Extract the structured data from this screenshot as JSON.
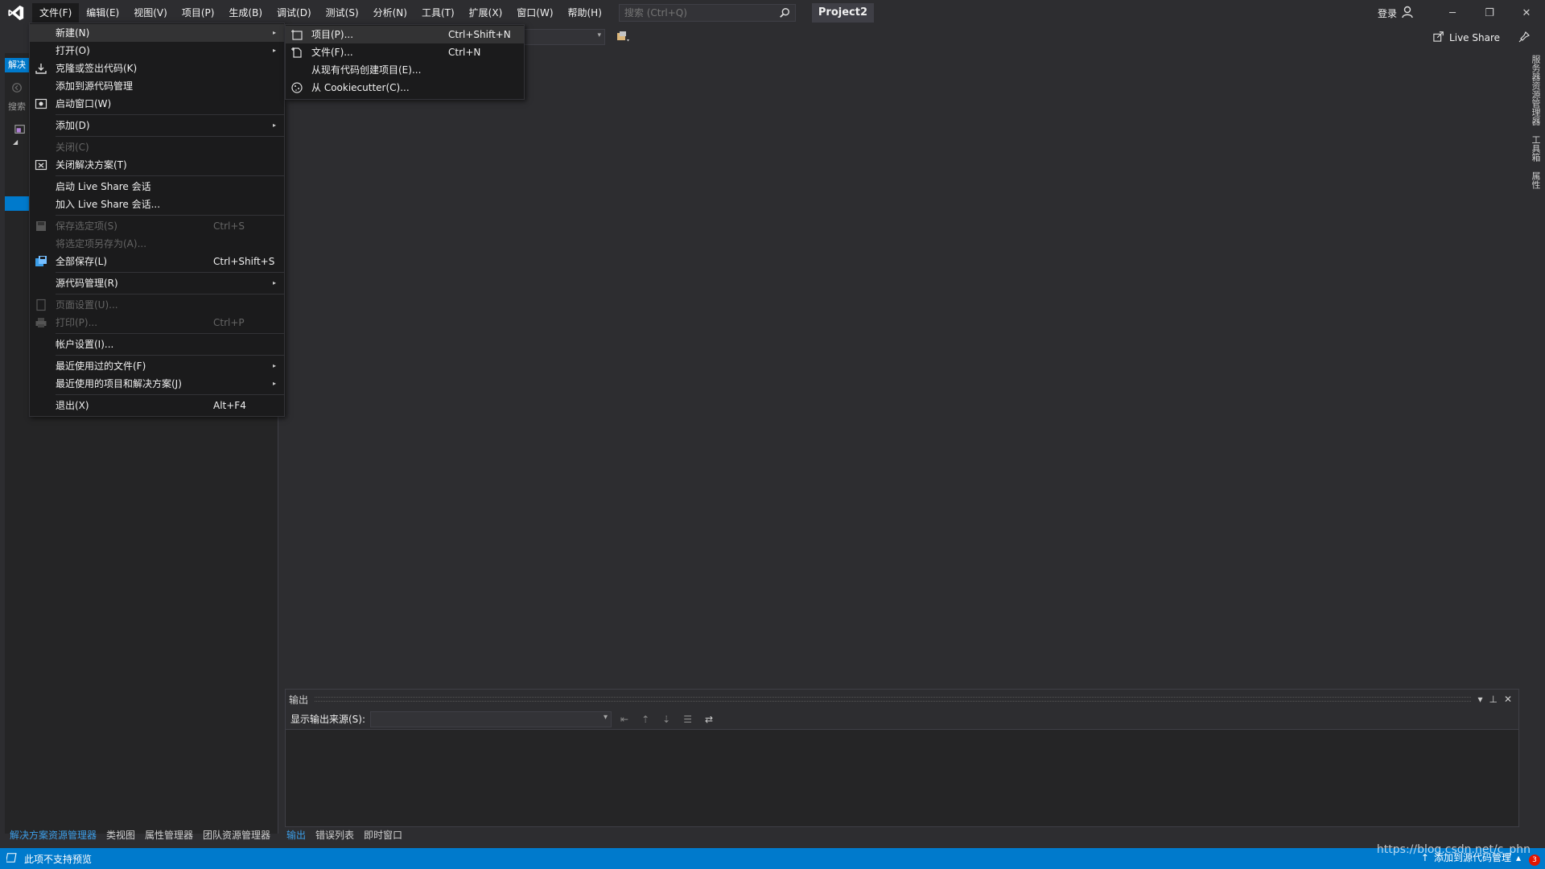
{
  "menubar": {
    "items": [
      "文件(F)",
      "编辑(E)",
      "视图(V)",
      "项目(P)",
      "生成(B)",
      "调试(D)",
      "测试(S)",
      "分析(N)",
      "工具(T)",
      "扩展(X)",
      "窗口(W)",
      "帮助(H)"
    ]
  },
  "search": {
    "placeholder": "搜索 (Ctrl+Q)"
  },
  "project_name": "Project2",
  "signin": "登录",
  "liveshare": "Live Share",
  "left_panel": {
    "tab": "解决",
    "search": "搜索"
  },
  "file_menu": {
    "items": [
      {
        "label": "新建(N)",
        "shortcut": "",
        "arrow": "▸"
      },
      {
        "label": "打开(O)",
        "shortcut": "",
        "arrow": "▸"
      },
      {
        "label": "克隆或签出代码(K)",
        "shortcut": ""
      },
      {
        "label": "添加到源代码管理",
        "shortcut": ""
      },
      {
        "label": "启动窗口(W)",
        "shortcut": ""
      },
      {
        "label": "添加(D)",
        "shortcut": "",
        "arrow": "▸"
      },
      {
        "label": "关闭(C)",
        "shortcut": ""
      },
      {
        "label": "关闭解决方案(T)",
        "shortcut": ""
      },
      {
        "label": "启动 Live Share 会话",
        "shortcut": ""
      },
      {
        "label": "加入 Live Share 会话...",
        "shortcut": ""
      },
      {
        "label": "保存选定项(S)",
        "shortcut": "Ctrl+S"
      },
      {
        "label": "将选定项另存为(A)...",
        "shortcut": ""
      },
      {
        "label": "全部保存(L)",
        "shortcut": "Ctrl+Shift+S"
      },
      {
        "label": "源代码管理(R)",
        "shortcut": "",
        "arrow": "▸"
      },
      {
        "label": "页面设置(U)...",
        "shortcut": ""
      },
      {
        "label": "打印(P)...",
        "shortcut": "Ctrl+P"
      },
      {
        "label": "帐户设置(I)...",
        "shortcut": ""
      },
      {
        "label": "最近使用过的文件(F)",
        "shortcut": "",
        "arrow": "▸"
      },
      {
        "label": "最近使用的项目和解决方案(J)",
        "shortcut": "",
        "arrow": "▸"
      },
      {
        "label": "退出(X)",
        "shortcut": "Alt+F4"
      }
    ]
  },
  "new_menu": {
    "items": [
      {
        "label": "项目(P)...",
        "shortcut": "Ctrl+Shift+N"
      },
      {
        "label": "文件(F)...",
        "shortcut": "Ctrl+N"
      },
      {
        "label": "从现有代码创建项目(E)...",
        "shortcut": ""
      },
      {
        "label": "从 Cookiecutter(C)...",
        "shortcut": ""
      }
    ]
  },
  "right_strip": {
    "tabs": [
      "服务器资源管理器",
      "工具箱",
      "属性"
    ]
  },
  "output": {
    "title": "输出",
    "source_label": "显示输出来源(S):"
  },
  "bottom_tabs_left": [
    "解决方案资源管理器",
    "类视图",
    "属性管理器",
    "团队资源管理器"
  ],
  "bottom_tabs_right": [
    "输出",
    "错误列表",
    "即时窗口"
  ],
  "status": {
    "left": "此项不支持预览",
    "right": "添加到源代码管理",
    "badge": "3"
  },
  "watermark": "https://blog.csdn.net/c_phn",
  "colors": {
    "accent": "#007acc",
    "background": "#2d2d30",
    "menu_bg": "#1b1b1c"
  }
}
